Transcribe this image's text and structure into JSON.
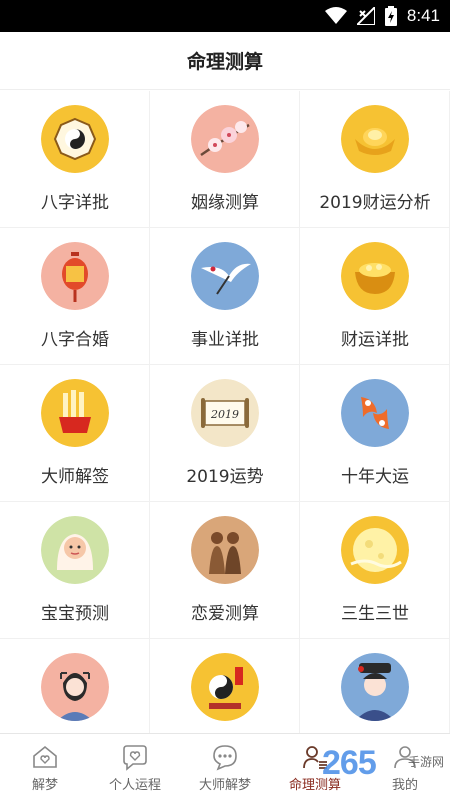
{
  "status_bar": {
    "time": "8:41"
  },
  "header": {
    "title": "命理测算"
  },
  "grid": {
    "items": [
      {
        "label": "八字详批",
        "icon": "bagua-icon"
      },
      {
        "label": "姻缘测算",
        "icon": "plum-blossom-icon"
      },
      {
        "label": "2019财运分析",
        "icon": "gold-ingot-icon"
      },
      {
        "label": "八字合婚",
        "icon": "lantern-icon"
      },
      {
        "label": "事业详批",
        "icon": "crane-icon"
      },
      {
        "label": "财运详批",
        "icon": "treasure-bowl-icon"
      },
      {
        "label": "大师解签",
        "icon": "fortune-sticks-icon"
      },
      {
        "label": "2019运势",
        "icon": "scroll-icon"
      },
      {
        "label": "十年大运",
        "icon": "koi-fish-icon"
      },
      {
        "label": "宝宝预测",
        "icon": "baby-icon"
      },
      {
        "label": "恋爱测算",
        "icon": "couple-icon"
      },
      {
        "label": "三生三世",
        "icon": "moon-icon"
      },
      {
        "label": "",
        "icon": "face-reading-icon"
      },
      {
        "label": "",
        "icon": "taiji-book-icon"
      },
      {
        "label": "",
        "icon": "qing-lady-icon"
      }
    ]
  },
  "tabbar": {
    "items": [
      {
        "label": "解梦",
        "icon": "house-heart-icon"
      },
      {
        "label": "个人运程",
        "icon": "heart-chat-icon"
      },
      {
        "label": "大师解梦",
        "icon": "chat-dots-icon"
      },
      {
        "label": "命理测算",
        "icon": "person-list-icon"
      },
      {
        "label": "我的",
        "icon": "person-icon"
      }
    ],
    "active_index": 3
  },
  "watermark": {
    "number": "265",
    "site": "手游网"
  },
  "colors": {
    "accent": "#8a2b1f",
    "icon_gold": "#f6c233",
    "icon_peach": "#f4b2a2",
    "icon_blue": "#7fa9d8"
  }
}
